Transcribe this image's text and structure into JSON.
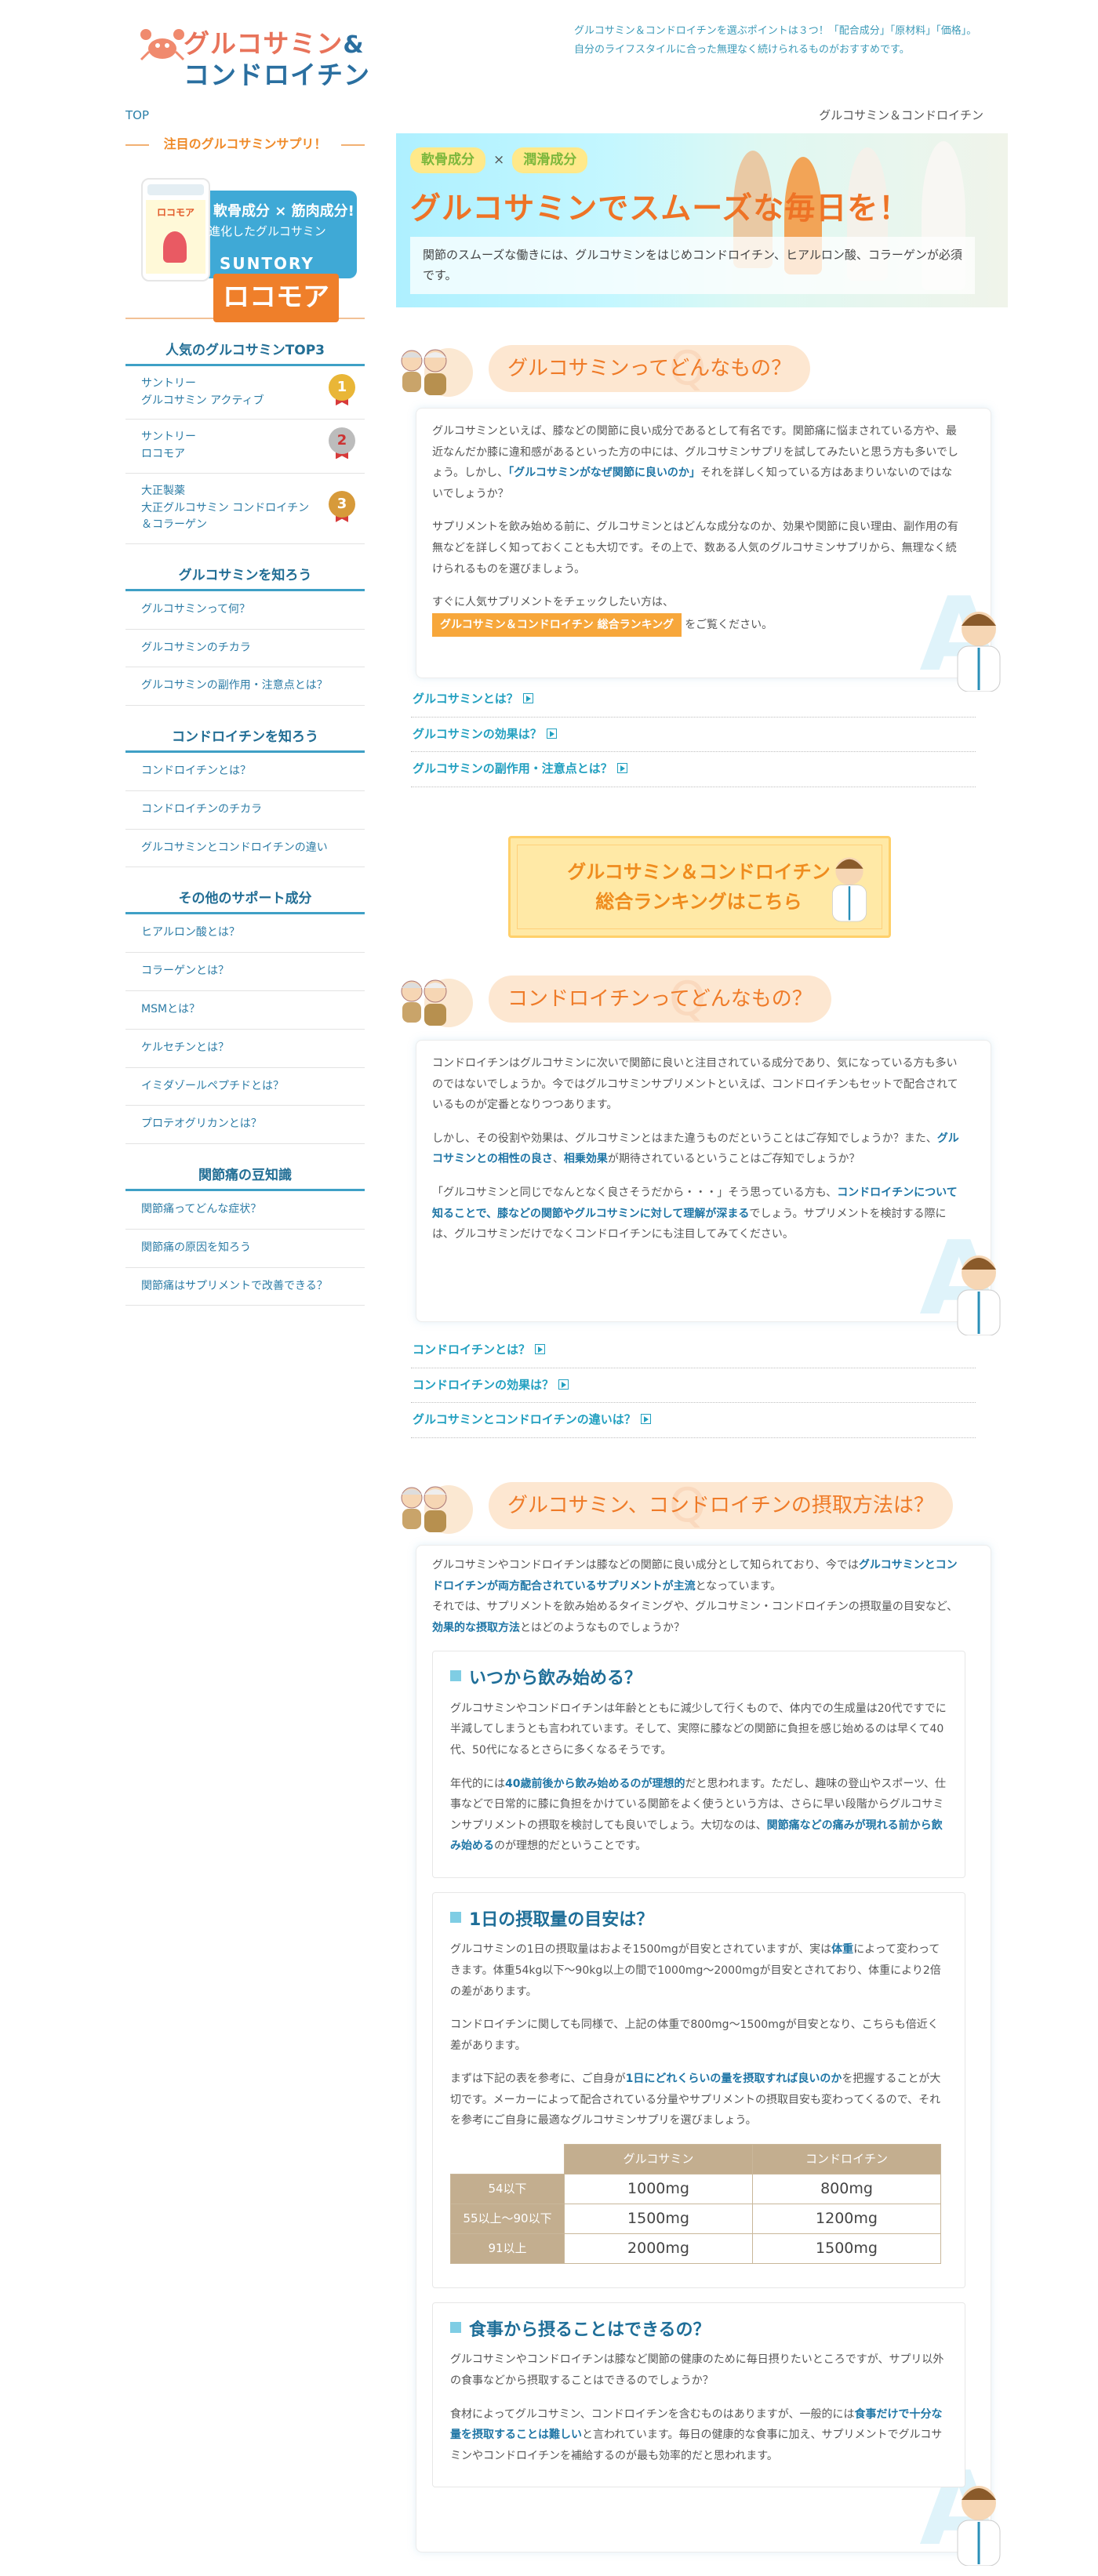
{
  "header": {
    "logo_line1": "グルコサミン",
    "logo_amp": "&",
    "logo_line2": "コンドロイチン",
    "note": "グルコサミン＆コンドロイチンを選ぶポイントは３つ！「配合成分」「原材料」「価格」。自分のライフスタイルに合った無理なく続けられるものがおすすめです。",
    "nav_top": "TOP",
    "breadcrumb": "グルコサミン＆コンドロイチン"
  },
  "sidebar": {
    "featured_title": "注目のグルコサミンサプリ！",
    "featured": {
      "bottle_label": "ロコモア",
      "catch1": "軟骨成分 × 筋肉成分!",
      "catch2": "進化したグルコサミン",
      "brand": "SUNTORY",
      "product": "ロコモア"
    },
    "ranking_heading": "人気のグルコサミンTOP3",
    "ranking": [
      {
        "maker": "サントリー",
        "name": "グルコサミン アクティブ",
        "rank": "1"
      },
      {
        "maker": "サントリー",
        "name": "ロコモア",
        "rank": "2"
      },
      {
        "maker": "大正製薬",
        "name": "大正グルコサミン コンドロイチン＆コラーゲン",
        "rank": "3"
      }
    ],
    "sections": [
      {
        "heading": "グルコサミンを知ろう",
        "items": [
          "グルコサミンって何？",
          "グルコサミンのチカラ",
          "グルコサミンの副作用・注意点とは？"
        ]
      },
      {
        "heading": "コンドロイチンを知ろう",
        "items": [
          "コンドロイチンとは？",
          "コンドロイチンのチカラ",
          "グルコサミンとコンドロイチンの違い"
        ]
      },
      {
        "heading": "その他のサポート成分",
        "items": [
          "ヒアルロン酸とは？",
          "コラーゲンとは？",
          "MSMとは？",
          "ケルセチンとは？",
          "イミダゾールペプチドとは？",
          "プロテオグリカンとは？"
        ]
      },
      {
        "heading": "関節痛の豆知識",
        "items": [
          "関節痛ってどんな症状？",
          "関節痛の原因を知ろう",
          "関節痛はサプリメントで改善できる？"
        ]
      }
    ]
  },
  "hero": {
    "tag1": "軟骨成分",
    "times": "×",
    "tag2": "潤滑成分",
    "title": "グルコサミンでスムーズな毎日を！",
    "desc": "関節のスムーズな働きには、グルコサミンをはじめコンドロイチン、ヒアルロン酸、コラーゲンが必須です。"
  },
  "s1": {
    "heading": "グルコサミンってどんなもの？",
    "ghost": "Q",
    "p1a": "グルコサミンといえば、膝などの関節に良い成分であるとして有名です。関節痛に悩まされている方や、最近なんだか膝に違和感があるといった方の中には、グルコサミンサプリを試してみたいと思う方も多いでしょう。しかし、",
    "p1b": "「グルコサミンがなぜ関節に良いのか」",
    "p1c": "それを詳しく知っている方はあまりいないのではないでしょうか？",
    "p2": "サプリメントを飲み始める前に、グルコサミンとはどんな成分なのか、効果や関節に良い理由、副作用の有無などを詳しく知っておくことも大切です。その上で、数ある人気のグルコサミンサプリから、無理なく続けられるものを選びましょう。",
    "p3": "すぐに人気サプリメントをチェックしたい方は、",
    "p3tag": "グルコサミン＆コンドロイチン 総合ランキング",
    "p3end": "をご覧ください。",
    "links": [
      "グルコサミンとは？",
      "グルコサミンの効果は？",
      "グルコサミンの副作用・注意点とは？"
    ]
  },
  "rank_button": {
    "line1": "グルコサミン＆コンドロイチン",
    "line2": "総合ランキングはこちら"
  },
  "s2": {
    "heading": "コンドロイチンってどんなもの？",
    "ghost": "Q",
    "p1": "コンドロイチンはグルコサミンに次いで関節に良いと注目されている成分であり、気になっている方も多いのではないでしょうか。今ではグルコサミンサプリメントといえば、コンドロイチンもセットで配合されているものが定番となりつつあります。",
    "p2a": "しかし、その役割や効果は、グルコサミンとはまた違うものだということはご存知でしょうか？また、",
    "p2b": "グルコサミンとの相性の良さ",
    "p2c": "、",
    "p2d": "相乗効果",
    "p2e": "が期待されているということはご存知でしょうか？",
    "p3a": "「グルコサミンと同じでなんとなく良さそうだから・・・」そう思っている方も、",
    "p3b": "コンドロイチンについて知ることで、膝などの関節やグルコサミンに対して理解が深まる",
    "p3c": "でしょう。サプリメントを検討する際には、グルコサミンだけでなくコンドロイチンにも注目してみてください。",
    "links": [
      "コンドロイチンとは？",
      "コンドロイチンの効果は？",
      "グルコサミンとコンドロイチンの違いは？"
    ]
  },
  "s3": {
    "heading": "グルコサミン、コンドロイチンの摂取方法は？",
    "ghost": "Q",
    "intro_a": "グルコサミンやコンドロイチンは膝などの関節に良い成分として知られており、今では",
    "intro_b": "グルコサミンとコンドロイチンが両方配合されているサプリメントが主流",
    "intro_c": "となっています。",
    "intro2a": "それでは、サプリメントを飲み始めるタイミングや、グルコサミン・コンドロイチンの摂取量の目安など、",
    "intro2b": "効果的な摂取方法",
    "intro2c": "とはどのようなものでしょうか？",
    "sub1": {
      "title": "いつから飲み始める？",
      "p1": "グルコサミンやコンドロイチンは年齢とともに減少して行くもので、体内での生成量は20代ですでに半減してしまうとも言われています。そして、実際に膝などの関節に負担を感じ始めるのは早くて40代、50代になるとさらに多くなるそうです。",
      "p2a": "年代的には",
      "p2b": "40歳前後から飲み始めるのが理想的",
      "p2c": "だと思われます。ただし、趣味の登山やスポーツ、仕事などで日常的に膝に負担をかけている関節をよく使うという方は、さらに早い段階からグルコサミンサプリメントの摂取を検討しても良いでしょう。大切なのは、",
      "p2d": "関節痛などの痛みが現れる前から飲み始める",
      "p2e": "のが理想的だということです。"
    },
    "sub2": {
      "title": "1日の摂取量の目安は？",
      "p1a": "グルコサミンの1日の摂取量はおよそ1500mgが目安とされていますが、実は",
      "p1b": "体重",
      "p1c": "によって変わってきます。体重54kg以下〜90kg以上の間で1000mg〜2000mgが目安とされており、体重により2倍の差があります。",
      "p2": "コンドロイチンに関しても同様で、上記の体重で800mg〜1500mgが目安となり、こちらも倍近く差があります。",
      "p3a": "まずは下記の表を参考に、ご自身が",
      "p3b": "1日にどれくらいの量を摂取すれば良いのか",
      "p3c": "を把握することが大切です。メーカーによって配合されている分量やサプリメントの摂取目安も変わってくるので、それを参考にご自身に最適なグルコサミンサプリを選びましょう。",
      "table": {
        "headers": [
          "グルコサミン",
          "コンドロイチン"
        ],
        "rows": [
          {
            "label": "54以下",
            "g": "1000mg",
            "c": "800mg"
          },
          {
            "label": "55以上〜90以下",
            "g": "1500mg",
            "c": "1200mg"
          },
          {
            "label": "91以上",
            "g": "2000mg",
            "c": "1500mg"
          }
        ]
      }
    },
    "sub3": {
      "title": "食事から摂ることはできるの？",
      "p1": "グルコサミンやコンドロイチンは膝など関節の健康のために毎日摂りたいところですが、サプリ以外の食事などから摂取することはできるのでしょうか？",
      "p2a": "食材によってグルコサミン、コンドロイチンを含むものはありますが、一般的には",
      "p2b": "食事だけで十分な量を摂取することは難しい",
      "p2c": "と言われています。毎日の健康的な食事に加え、サプリメントでグルコサミンやコンドロイチンを補給するのが最も効率的だと思われます。"
    }
  },
  "colors": {
    "accent_orange": "#ef7b28",
    "accent_blue": "#1f76a6",
    "link_teal": "#22a0c0"
  },
  "icons": [
    "crab-logo-icon",
    "medal-gold-icon",
    "medal-silver-icon",
    "medal-bronze-icon",
    "link-arrow-icon",
    "doctor-icon",
    "elderly-couple-icon"
  ]
}
